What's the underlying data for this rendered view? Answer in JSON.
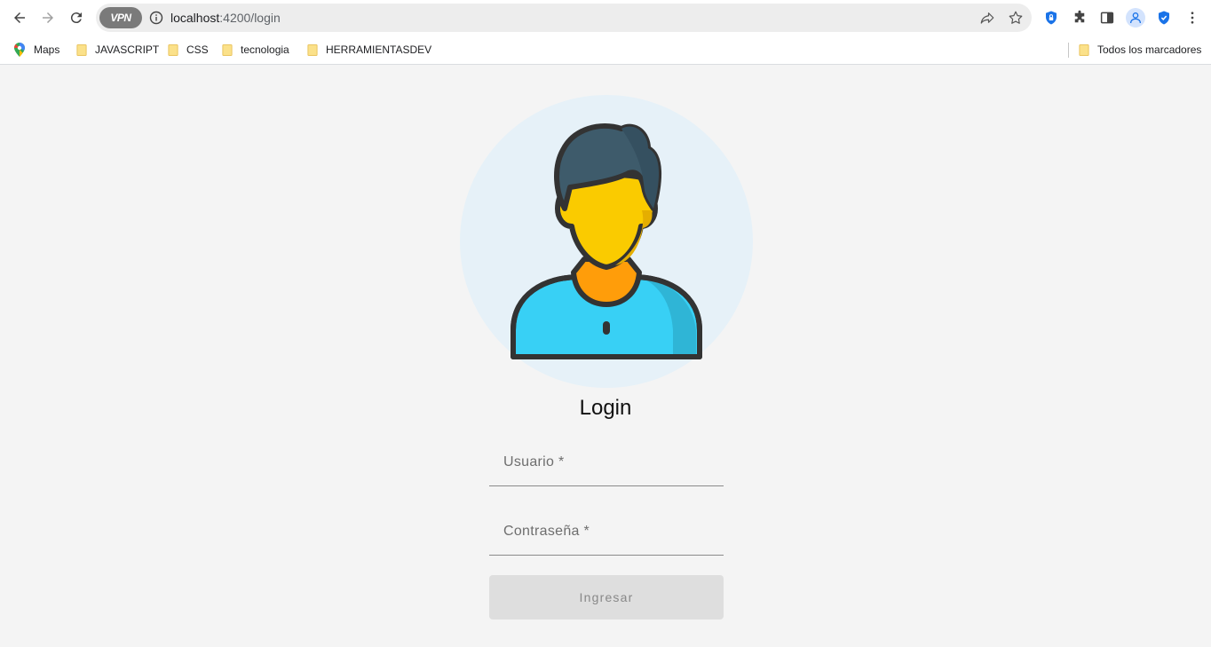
{
  "browser": {
    "url_host": "localhost",
    "url_path": ":4200/login",
    "vpn_label": "VPN",
    "bookmarks": [
      {
        "label": "Maps",
        "icon": "maps-icon"
      },
      {
        "label": "JAVASCRIPT",
        "icon": "folder-icon"
      },
      {
        "label": "CSS",
        "icon": "folder-icon"
      },
      {
        "label": "tecnologia",
        "icon": "folder-icon"
      },
      {
        "label": "HERRAMIENTASDEV",
        "icon": "folder-icon"
      }
    ],
    "all_bookmarks_label": "Todos los marcadores"
  },
  "login": {
    "title": "Login",
    "username_label": "Usuario *",
    "password_label": "Contraseña *",
    "submit_label": "Ingresar"
  },
  "colors": {
    "page_bg": "#f4f4f4",
    "avatar_bg": "#e6f1f8",
    "hair": "#3e5b6b",
    "face": "#facb00",
    "neck": "#ff9d0a",
    "shirt": "#38d0f5",
    "button_disabled": "#dedede"
  }
}
